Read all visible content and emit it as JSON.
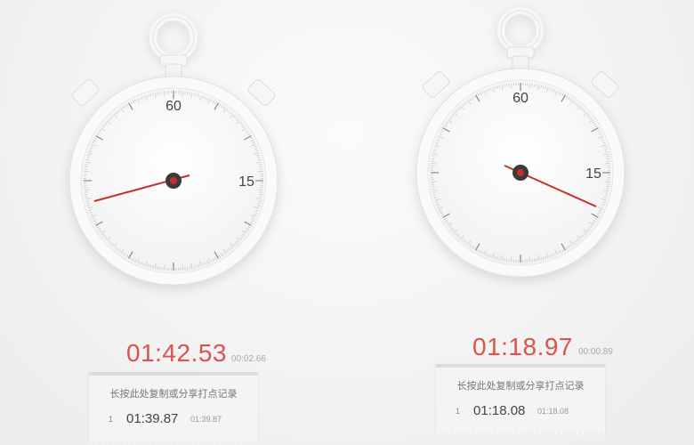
{
  "stopwatches": [
    {
      "main_time": "01:42.53",
      "lap_time": "00:02.66",
      "dial": {
        "label_top": "60",
        "label_right": "15"
      },
      "receipt": {
        "hint": "长按此处复制或分享打点记录",
        "laps": [
          {
            "index": "1",
            "total": "01:39.87",
            "split": "01:39.87"
          }
        ]
      }
    },
    {
      "main_time": "01:18.97",
      "lap_time": "00:00.89",
      "dial": {
        "label_top": "60",
        "label_right": "15"
      },
      "receipt": {
        "hint": "长按此处复制或分享打点记录",
        "laps": [
          {
            "index": "1",
            "total": "01:18.08",
            "split": "01:18.08"
          }
        ]
      }
    }
  ],
  "colors": {
    "accent": "#d9534f",
    "hand": "#c9302c",
    "hub": "#3a3a3a"
  }
}
